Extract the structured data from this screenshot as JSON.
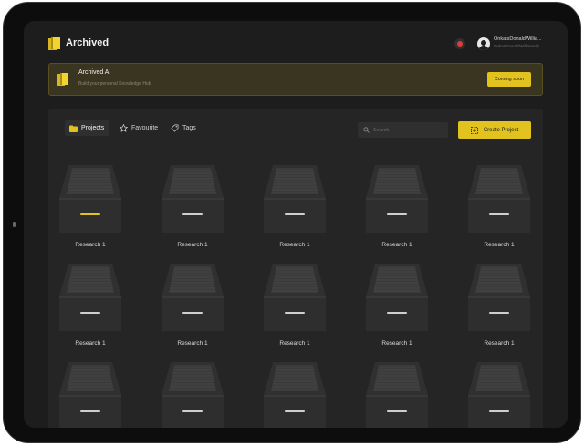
{
  "app": {
    "title": "Archived"
  },
  "header": {
    "user_name": "OnkatsDonaldWillia...",
    "user_email": "OnkatsDonaldWilliams@..."
  },
  "banner": {
    "title": "Archived AI",
    "subtitle": "Build your personal Knowledge Hub",
    "button_label": "Coming soon"
  },
  "tabs": [
    {
      "label": "Projects",
      "icon": "folder-icon",
      "active": true
    },
    {
      "label": "Favourite",
      "icon": "star-icon",
      "active": false
    },
    {
      "label": "Tags",
      "icon": "tag-icon",
      "active": false
    }
  ],
  "search": {
    "placeholder": "Search"
  },
  "create_button": {
    "label": "Create Project"
  },
  "colors": {
    "accent": "#E1C21F",
    "background": "#1D1D1D",
    "panel": "#252525"
  },
  "projects": [
    {
      "label": "Research 1",
      "selected": true
    },
    {
      "label": "Research 1"
    },
    {
      "label": "Research 1"
    },
    {
      "label": "Research 1"
    },
    {
      "label": "Research 1"
    },
    {
      "label": "Research 1"
    },
    {
      "label": "Research 1"
    },
    {
      "label": "Research 1"
    },
    {
      "label": "Research 1"
    },
    {
      "label": "Research 1"
    },
    {
      "label": ""
    },
    {
      "label": ""
    },
    {
      "label": ""
    },
    {
      "label": ""
    },
    {
      "label": ""
    }
  ]
}
